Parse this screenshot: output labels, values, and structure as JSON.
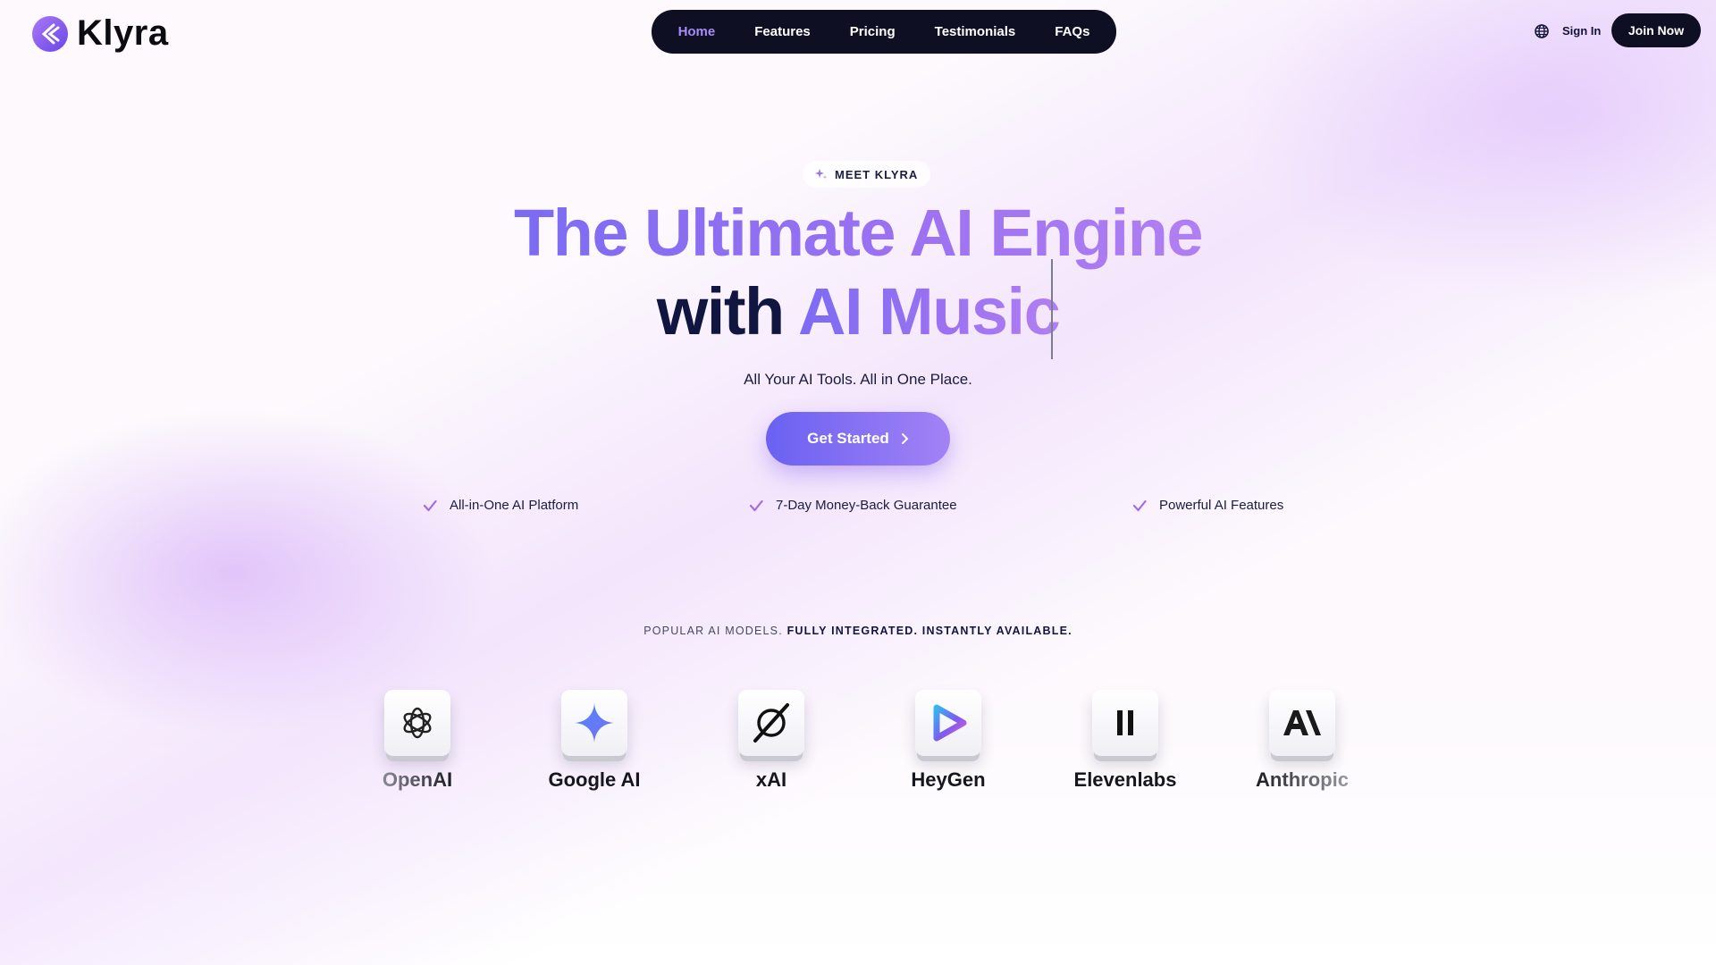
{
  "header": {
    "logo_text": "Klyra",
    "nav": [
      {
        "label": "Home",
        "active": true
      },
      {
        "label": "Features",
        "active": false
      },
      {
        "label": "Pricing",
        "active": false
      },
      {
        "label": "Testimonials",
        "active": false
      },
      {
        "label": "FAQs",
        "active": false
      }
    ],
    "sign_in": "Sign In",
    "join": "Join Now"
  },
  "hero": {
    "eyebrow": "MEET KLYRA",
    "line1": "The Ultimate AI Engine",
    "line2_dark": "with ",
    "line2_grad": "AI Music",
    "subtitle": "All Your AI Tools. All in One Place.",
    "cta": "Get Started",
    "features": [
      "All-in-One AI Platform",
      "7-Day Money-Back Guarantee",
      "Powerful AI Features"
    ]
  },
  "models": {
    "title_light": "POPULAR AI MODELS.",
    "title_bold": "FULLY INTEGRATED. INSTANTLY AVAILABLE.",
    "items": [
      {
        "name": "OpenAI",
        "icon": "openai-icon"
      },
      {
        "name": "Google AI",
        "icon": "google-ai-icon"
      },
      {
        "name": "xAI",
        "icon": "xai-icon"
      },
      {
        "name": "HeyGen",
        "icon": "heygen-icon"
      },
      {
        "name": "Elevenlabs",
        "icon": "elevenlabs-icon"
      },
      {
        "name": "Anthropic",
        "icon": "anthropic-icon"
      }
    ]
  },
  "colors": {
    "accent": "#8b6ff3",
    "nav_bg": "#0e0f22",
    "heading_dark": "#101640",
    "check": "#a46be6"
  }
}
